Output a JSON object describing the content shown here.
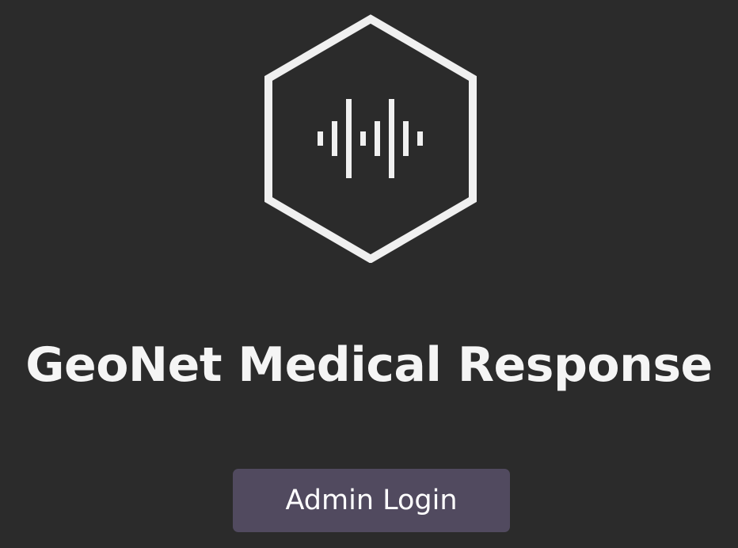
{
  "app": {
    "logo_icon": "hexagon-waveform-icon",
    "title": "GeoNet Medical Response"
  },
  "actions": {
    "login_label": "Admin Login"
  },
  "colors": {
    "background": "#2b2b2b",
    "foreground": "#f5f5f5",
    "button": "#514a5f"
  }
}
